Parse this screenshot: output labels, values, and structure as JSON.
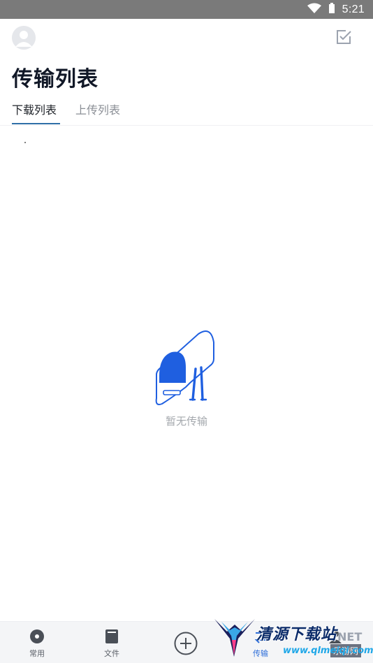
{
  "status_bar": {
    "time": "5:21",
    "wifi_icon": "wifi-icon",
    "battery_icon": "battery-icon"
  },
  "header": {
    "avatar_icon": "user-avatar-icon",
    "select_icon": "checkbox-icon"
  },
  "page": {
    "title": "传输列表"
  },
  "tabs": [
    {
      "label": "下载列表",
      "active": true
    },
    {
      "label": "上传列表",
      "active": false
    }
  ],
  "empty_state": {
    "illustration": "empty-transfer-illustration",
    "text": "暂无传输"
  },
  "bottom_nav": [
    {
      "label": "常用",
      "icon": "disc-icon",
      "active": false
    },
    {
      "label": "文件",
      "icon": "file-icon",
      "active": false
    },
    {
      "label": "",
      "icon": "add-circle-icon",
      "active": false
    },
    {
      "label": "传输",
      "icon": "transfer-icon",
      "active": true
    },
    {
      "label": "",
      "icon": "user-icon",
      "active": false
    }
  ],
  "watermark": {
    "title": "清源下载站",
    "domain": "www.qlmeiqi.com",
    "net": "NET",
    "sub": "乐游网"
  },
  "colors": {
    "accent": "#2f6fa8",
    "active_nav": "#2f6fd9",
    "illustration_blue": "#1f5fe0",
    "status_bar": "#7a7a7a"
  }
}
